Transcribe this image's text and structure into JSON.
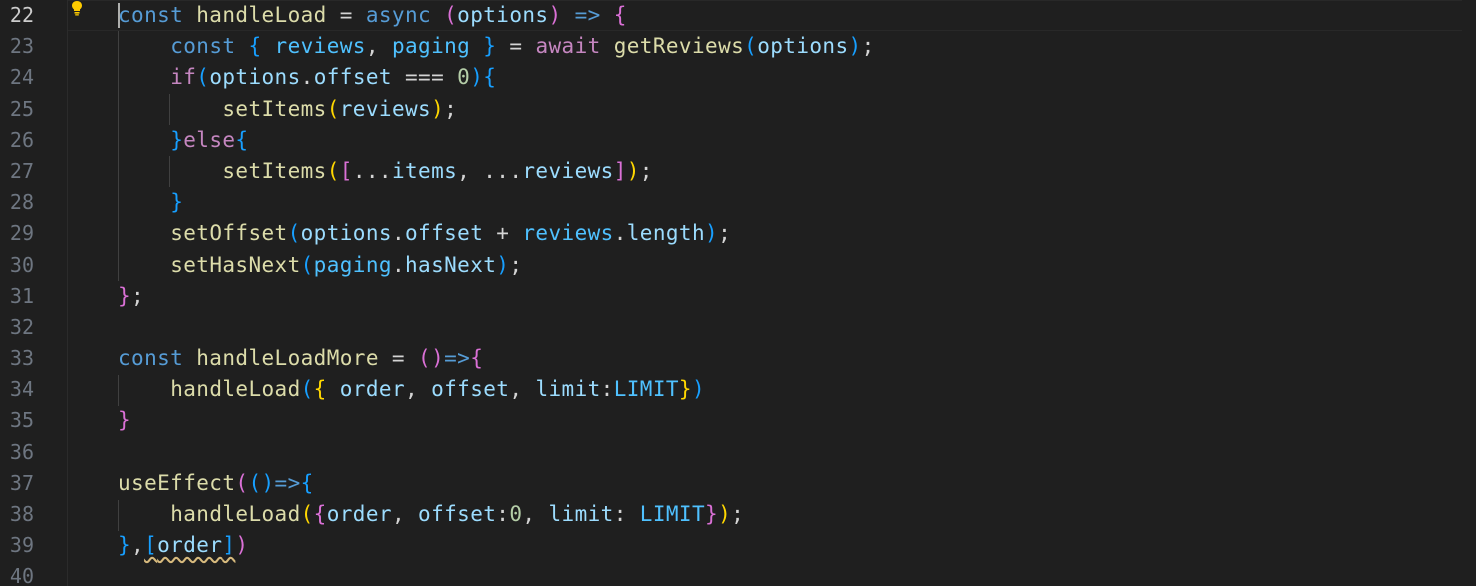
{
  "editor": {
    "lightbulb_icon": "lightbulb-icon",
    "colors": {
      "background": "#1f1f1f",
      "keyword": "#569cd6",
      "control": "#c586c0",
      "function": "#dcdcaa",
      "variable": "#9cdcfe",
      "number": "#b5cea8",
      "constant": "#4fc1ff",
      "bracket_1": "#ffd700",
      "bracket_2": "#da70d6",
      "bracket_3": "#179fff"
    },
    "lines": [
      {
        "number": "22",
        "current": true,
        "tokens": [
          {
            "t": "const",
            "c": "kw"
          },
          {
            "t": " "
          },
          {
            "t": "handleLoad",
            "c": "fn"
          },
          {
            "t": " = "
          },
          {
            "t": "async",
            "c": "kw"
          },
          {
            "t": " "
          },
          {
            "t": "(",
            "c": "b2"
          },
          {
            "t": "options",
            "c": "var"
          },
          {
            "t": ")",
            "c": "b2"
          },
          {
            "t": " "
          },
          {
            "t": "=>",
            "c": "kw"
          },
          {
            "t": " "
          },
          {
            "t": "{",
            "c": "b2"
          }
        ]
      },
      {
        "number": "23",
        "tokens": [
          {
            "t": "    "
          },
          {
            "t": "const",
            "c": "kw"
          },
          {
            "t": " "
          },
          {
            "t": "{",
            "c": "b3"
          },
          {
            "t": " "
          },
          {
            "t": "reviews",
            "c": "cst"
          },
          {
            "t": ", "
          },
          {
            "t": "paging",
            "c": "cst"
          },
          {
            "t": " "
          },
          {
            "t": "}",
            "c": "b3"
          },
          {
            "t": " = "
          },
          {
            "t": "await",
            "c": "ctl"
          },
          {
            "t": " "
          },
          {
            "t": "getReviews",
            "c": "fn"
          },
          {
            "t": "(",
            "c": "b3"
          },
          {
            "t": "options",
            "c": "var"
          },
          {
            "t": ")",
            "c": "b3"
          },
          {
            "t": ";"
          }
        ]
      },
      {
        "number": "24",
        "tokens": [
          {
            "t": "    "
          },
          {
            "t": "if",
            "c": "ctl"
          },
          {
            "t": "(",
            "c": "b3"
          },
          {
            "t": "options",
            "c": "var"
          },
          {
            "t": "."
          },
          {
            "t": "offset",
            "c": "var"
          },
          {
            "t": " === "
          },
          {
            "t": "0",
            "c": "num"
          },
          {
            "t": ")",
            "c": "b3"
          },
          {
            "t": "{",
            "c": "b3"
          }
        ]
      },
      {
        "number": "25",
        "tokens": [
          {
            "t": "        "
          },
          {
            "t": "setItems",
            "c": "fn"
          },
          {
            "t": "(",
            "c": "b1"
          },
          {
            "t": "reviews",
            "c": "var"
          },
          {
            "t": ")",
            "c": "b1"
          },
          {
            "t": ";"
          }
        ]
      },
      {
        "number": "26",
        "tokens": [
          {
            "t": "    "
          },
          {
            "t": "}",
            "c": "b3"
          },
          {
            "t": "else",
            "c": "ctl"
          },
          {
            "t": "{",
            "c": "b3"
          }
        ]
      },
      {
        "number": "27",
        "tokens": [
          {
            "t": "        "
          },
          {
            "t": "setItems",
            "c": "fn"
          },
          {
            "t": "(",
            "c": "b1"
          },
          {
            "t": "[",
            "c": "b2"
          },
          {
            "t": "..."
          },
          {
            "t": "items",
            "c": "var"
          },
          {
            "t": ", ..."
          },
          {
            "t": "reviews",
            "c": "var"
          },
          {
            "t": "]",
            "c": "b2"
          },
          {
            "t": ")",
            "c": "b1"
          },
          {
            "t": ";"
          }
        ]
      },
      {
        "number": "28",
        "tokens": [
          {
            "t": "    "
          },
          {
            "t": "}",
            "c": "b3"
          }
        ]
      },
      {
        "number": "29",
        "tokens": [
          {
            "t": "    "
          },
          {
            "t": "setOffset",
            "c": "fn"
          },
          {
            "t": "(",
            "c": "b3"
          },
          {
            "t": "options",
            "c": "var"
          },
          {
            "t": "."
          },
          {
            "t": "offset",
            "c": "var"
          },
          {
            "t": " + "
          },
          {
            "t": "reviews",
            "c": "cst"
          },
          {
            "t": "."
          },
          {
            "t": "length",
            "c": "var"
          },
          {
            "t": ")",
            "c": "b3"
          },
          {
            "t": ";"
          }
        ]
      },
      {
        "number": "30",
        "tokens": [
          {
            "t": "    "
          },
          {
            "t": "setHasNext",
            "c": "fn"
          },
          {
            "t": "(",
            "c": "b3"
          },
          {
            "t": "paging",
            "c": "cst"
          },
          {
            "t": "."
          },
          {
            "t": "hasNext",
            "c": "var"
          },
          {
            "t": ")",
            "c": "b3"
          },
          {
            "t": ";"
          }
        ]
      },
      {
        "number": "31",
        "tokens": [
          {
            "t": "}",
            "c": "b2"
          },
          {
            "t": ";"
          }
        ]
      },
      {
        "number": "32",
        "tokens": []
      },
      {
        "number": "33",
        "tokens": [
          {
            "t": "const",
            "c": "kw"
          },
          {
            "t": " "
          },
          {
            "t": "handleLoadMore",
            "c": "fn"
          },
          {
            "t": " = "
          },
          {
            "t": "(",
            "c": "b2"
          },
          {
            "t": ")",
            "c": "b2"
          },
          {
            "t": "=>",
            "c": "kw"
          },
          {
            "t": "{",
            "c": "b2"
          }
        ]
      },
      {
        "number": "34",
        "tokens": [
          {
            "t": "    "
          },
          {
            "t": "handleLoad",
            "c": "fn"
          },
          {
            "t": "(",
            "c": "b3"
          },
          {
            "t": "{",
            "c": "b1"
          },
          {
            "t": " "
          },
          {
            "t": "order",
            "c": "var"
          },
          {
            "t": ", "
          },
          {
            "t": "offset",
            "c": "var"
          },
          {
            "t": ", "
          },
          {
            "t": "limit",
            "c": "var"
          },
          {
            "t": ":"
          },
          {
            "t": "LIMIT",
            "c": "cst"
          },
          {
            "t": "}",
            "c": "b1"
          },
          {
            "t": ")",
            "c": "b3"
          }
        ]
      },
      {
        "number": "35",
        "tokens": [
          {
            "t": "}",
            "c": "b2"
          }
        ]
      },
      {
        "number": "36",
        "tokens": []
      },
      {
        "number": "37",
        "tokens": [
          {
            "t": "useEffect",
            "c": "fn"
          },
          {
            "t": "(",
            "c": "b2"
          },
          {
            "t": "(",
            "c": "b3"
          },
          {
            "t": ")",
            "c": "b3"
          },
          {
            "t": "=>",
            "c": "kw"
          },
          {
            "t": "{",
            "c": "b3"
          }
        ]
      },
      {
        "number": "38",
        "tokens": [
          {
            "t": "    "
          },
          {
            "t": "handleLoad",
            "c": "fn"
          },
          {
            "t": "(",
            "c": "b1"
          },
          {
            "t": "{",
            "c": "b2"
          },
          {
            "t": "order",
            "c": "var"
          },
          {
            "t": ", "
          },
          {
            "t": "offset",
            "c": "var"
          },
          {
            "t": ":"
          },
          {
            "t": "0",
            "c": "num"
          },
          {
            "t": ", "
          },
          {
            "t": "limit",
            "c": "var"
          },
          {
            "t": ": "
          },
          {
            "t": "LIMIT",
            "c": "cst"
          },
          {
            "t": "}",
            "c": "b2"
          },
          {
            "t": ")",
            "c": "b1"
          },
          {
            "t": ";"
          }
        ]
      },
      {
        "number": "39",
        "tokens": [
          {
            "t": "}",
            "c": "b3"
          },
          {
            "t": ","
          },
          {
            "t": "[",
            "c": "b3 squig"
          },
          {
            "t": "order",
            "c": "var squig"
          },
          {
            "t": "]",
            "c": "b3 squig"
          },
          {
            "t": ")",
            "c": "b2"
          }
        ]
      },
      {
        "number": "40",
        "tokens": []
      }
    ]
  }
}
